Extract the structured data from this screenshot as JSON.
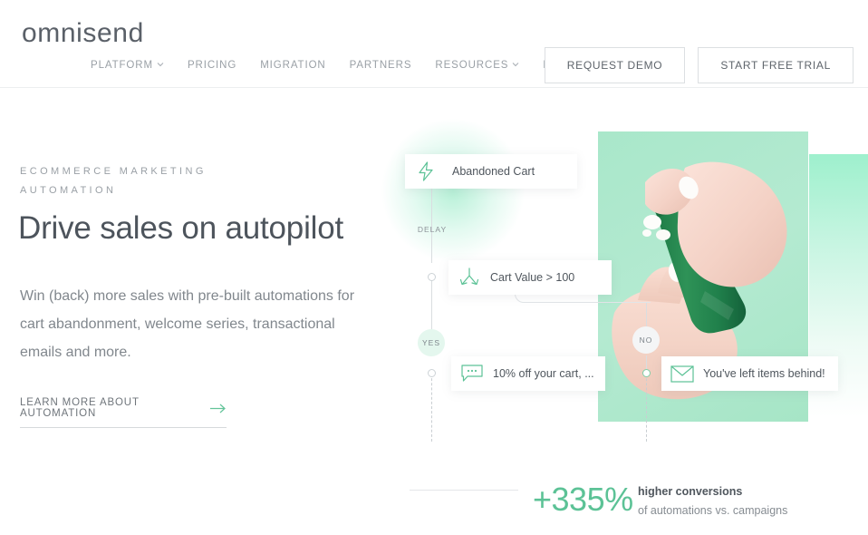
{
  "brand": {
    "logo_text": "omnisend",
    "accent_green": "#5cc296",
    "mint": "#a9e7ca"
  },
  "header": {
    "nav": [
      {
        "label": "PLATFORM",
        "has_chevron": true,
        "icon": "chevron-down-icon"
      },
      {
        "label": "PRICING",
        "has_chevron": false,
        "icon": ""
      },
      {
        "label": "MIGRATION",
        "has_chevron": false,
        "icon": ""
      },
      {
        "label": "PARTNERS",
        "has_chevron": false,
        "icon": ""
      },
      {
        "label": "RESOURCES",
        "has_chevron": true,
        "icon": "chevron-down-icon"
      },
      {
        "label": "BLOG",
        "has_chevron": false,
        "icon": ""
      }
    ],
    "request_demo": "REQUEST DEMO",
    "start_trial": "START FREE TRIAL"
  },
  "hero": {
    "eyebrow": "ECOMMERCE MARKETING AUTOMATION",
    "headline": "Drive sales on autopilot",
    "subcopy": "Win (back) more sales with pre-built automations for cart abandonment, welcome series, transactional emails and more.",
    "cta_label": "LEARN MORE ABOUT AUTOMATION",
    "cta_icon": "arrow-right-icon"
  },
  "workflow": {
    "trigger": {
      "label": "Abandoned Cart",
      "icon": "lightning-bolt-icon"
    },
    "delay_label": "DELAY",
    "split": {
      "label": "Cart Value > 100",
      "icon": "split-branch-icon"
    },
    "yes_label": "YES",
    "no_label": "NO",
    "sms": {
      "label": "10% off your cart, ...",
      "icon": "chat-bubble-icon"
    },
    "email": {
      "label": "You've left items behind!",
      "icon": "envelope-icon"
    }
  },
  "stat": {
    "value": "+335%",
    "title": "higher conversions",
    "subtitle": "of automations vs. campaigns"
  }
}
